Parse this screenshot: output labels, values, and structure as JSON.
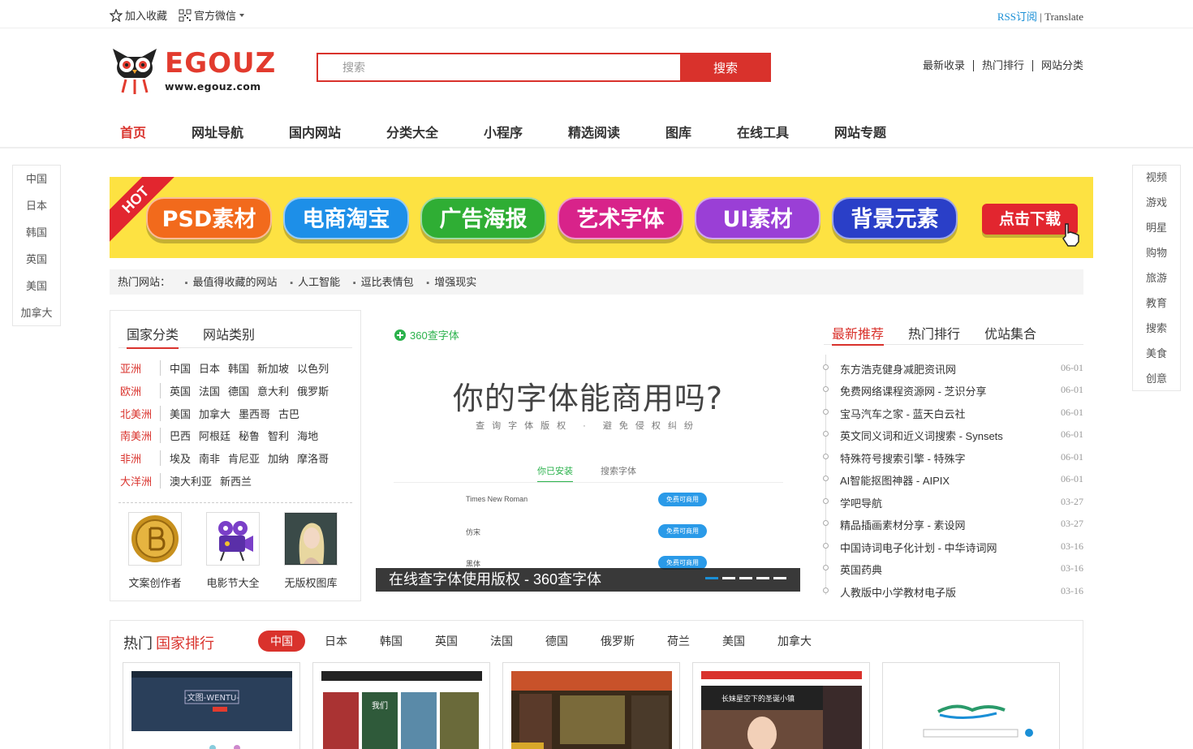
{
  "topbar": {
    "favorite": "加入收藏",
    "wechat": "官方微信",
    "rss": "RSS订阅",
    "sep": "|",
    "translate": "Translate"
  },
  "logo": {
    "name": "EGOUZ",
    "url": "www.egouz.com"
  },
  "search": {
    "placeholder": "搜索",
    "button": "搜索"
  },
  "header_links": [
    "最新收录",
    "热门排行",
    "网站分类"
  ],
  "nav": [
    "首页",
    "网址导航",
    "国内网站",
    "分类大全",
    "小程序",
    "精选阅读",
    "图库",
    "在线工具",
    "网站专题"
  ],
  "side_left": [
    "中国",
    "日本",
    "韩国",
    "英国",
    "美国",
    "加拿大"
  ],
  "side_right": [
    "视频",
    "游戏",
    "明星",
    "购物",
    "旅游",
    "教育",
    "搜索",
    "美食",
    "创意"
  ],
  "banner": {
    "hot": "HOT",
    "pills": [
      "PSD素材",
      "电商淘宝",
      "广告海报",
      "艺术字体",
      "UI素材",
      "背景元素"
    ],
    "download": "点击下载"
  },
  "hotbar": {
    "label": "热门网站：",
    "items": [
      "最值得收藏的网站",
      "人工智能",
      "逗比表情包",
      "增强现实"
    ]
  },
  "category": {
    "tabs": [
      "国家分类",
      "网站类别"
    ],
    "rows": [
      {
        "continent": "亚洲",
        "countries": [
          "中国",
          "日本",
          "韩国",
          "新加坡",
          "以色列"
        ]
      },
      {
        "continent": "欧洲",
        "countries": [
          "英国",
          "法国",
          "德国",
          "意大利",
          "俄罗斯"
        ]
      },
      {
        "continent": "北美洲",
        "countries": [
          "美国",
          "加拿大",
          "墨西哥",
          "古巴"
        ]
      },
      {
        "continent": "南美洲",
        "countries": [
          "巴西",
          "阿根廷",
          "秘鲁",
          "智利",
          "海地"
        ]
      },
      {
        "continent": "非洲",
        "countries": [
          "埃及",
          "南非",
          "肯尼亚",
          "加纳",
          "摩洛哥"
        ]
      },
      {
        "continent": "大洋洲",
        "countries": [
          "澳大利亚",
          "新西兰"
        ]
      }
    ],
    "thumbs": [
      "文案创作者",
      "电影节大全",
      "无版权图库"
    ]
  },
  "slider": {
    "logo": "360查字体",
    "headline": "你的字体能商用吗?",
    "sub": "查询字体版权 · 避免侵权纠纷",
    "tabs": [
      "你已安装",
      "搜索字体"
    ],
    "rows": [
      {
        "font": "Times New Roman",
        "badge": "免费可商用"
      },
      {
        "font": "仿宋",
        "badge": "免费可商用"
      },
      {
        "font": "黑体",
        "badge": "免费可商用"
      }
    ],
    "caption": "在线查字体使用版权 - 360查字体"
  },
  "recommend": {
    "tabs": [
      "最新推荐",
      "热门排行",
      "优站集合"
    ],
    "items": [
      {
        "title": "东方浩克健身减肥资讯网",
        "date": "06-01"
      },
      {
        "title": "免费网络课程资源网 - 芝识分享",
        "date": "06-01"
      },
      {
        "title": "宝马汽车之家 - 蓝天白云社",
        "date": "06-01"
      },
      {
        "title": "英文同义词和近义词搜索 - Synsets",
        "date": "06-01"
      },
      {
        "title": "特殊符号搜索引擎 - 特殊字",
        "date": "06-01"
      },
      {
        "title": "AI智能抠图神器 - AIPIX",
        "date": "06-01"
      },
      {
        "title": "学吧导航",
        "date": "03-27"
      },
      {
        "title": "精品插画素材分享 - 素设网",
        "date": "03-27"
      },
      {
        "title": "中国诗词电子化计划 - 中华诗词网",
        "date": "03-16"
      },
      {
        "title": "英国药典",
        "date": "03-16"
      },
      {
        "title": "人教版中小学教材电子版",
        "date": "03-16"
      }
    ]
  },
  "ranking": {
    "title_a": "热门",
    "title_b": "国家排行",
    "tabs": [
      "中国",
      "日本",
      "韩国",
      "英国",
      "法国",
      "德国",
      "俄罗斯",
      "荷兰",
      "美国",
      "加拿大"
    ],
    "card_texts": [
      "-文图-WENTU-",
      "我们",
      "长妹星空下的圣诞小镇"
    ]
  },
  "colors": {
    "accent": "#d9322c",
    "banner_bg": "#fde242",
    "link_blue": "#1a8fd6",
    "slider_green": "#2bb24c"
  }
}
